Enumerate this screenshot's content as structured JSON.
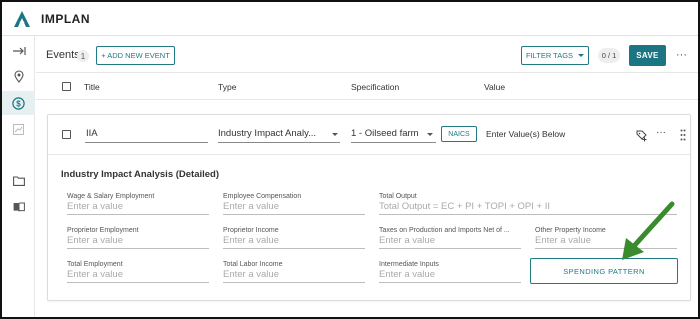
{
  "app": {
    "title": "IMPLAN",
    "brand_color": "#1b7582"
  },
  "sidebar": {
    "items": [
      {
        "icon": "collapse-arrow-icon",
        "active": false
      },
      {
        "icon": "location-pin-icon",
        "active": false
      },
      {
        "icon": "dollar-icon",
        "active": true
      },
      {
        "icon": "chart-icon",
        "active": false
      },
      {
        "icon": "folder-icon",
        "active": false
      },
      {
        "icon": "book-icon",
        "active": false
      }
    ]
  },
  "events_header": {
    "label": "Events",
    "count": "1",
    "add_button": "+ ADD NEW EVENT",
    "filter_button": "FILTER TAGS",
    "page_indicator": "0 / 1",
    "save_button": "SAVE",
    "more": "···"
  },
  "columns": [
    "Title",
    "Type",
    "Specification",
    "Value"
  ],
  "event": {
    "title": "IIA",
    "type": "Industry Impact Analy...",
    "specification": "1 - Oilseed farm",
    "naics_button": "NAICS",
    "value_hint": "Enter Value(s) Below",
    "more": "···"
  },
  "details": {
    "section_title": "Industry Impact Analysis (Detailed)",
    "fields": [
      {
        "label": "Wage & Salary Employment",
        "placeholder": "Enter a value"
      },
      {
        "label": "Employee Compensation",
        "placeholder": "Enter a value"
      },
      {
        "label": "Total Output",
        "placeholder": "Total Output = EC + PI + TOPI + OPI + II"
      },
      {
        "label": "Proprietor Employment",
        "placeholder": "Enter a value"
      },
      {
        "label": "Proprietor Income",
        "placeholder": "Enter a value"
      },
      {
        "label": "Taxes on Production and Imports Net of ...",
        "placeholder": "Enter a value"
      },
      {
        "label": "Other Property Income",
        "placeholder": "Enter a value"
      },
      {
        "label": "Total Employment",
        "placeholder": "Enter a value"
      },
      {
        "label": "Total Labor Income",
        "placeholder": "Enter a value"
      },
      {
        "label": "Intermediate Inputs",
        "placeholder": "Enter a value"
      }
    ],
    "spending_button": "SPENDING PATTERN"
  },
  "annotation": {
    "arrow_color": "#3a8a2e"
  }
}
